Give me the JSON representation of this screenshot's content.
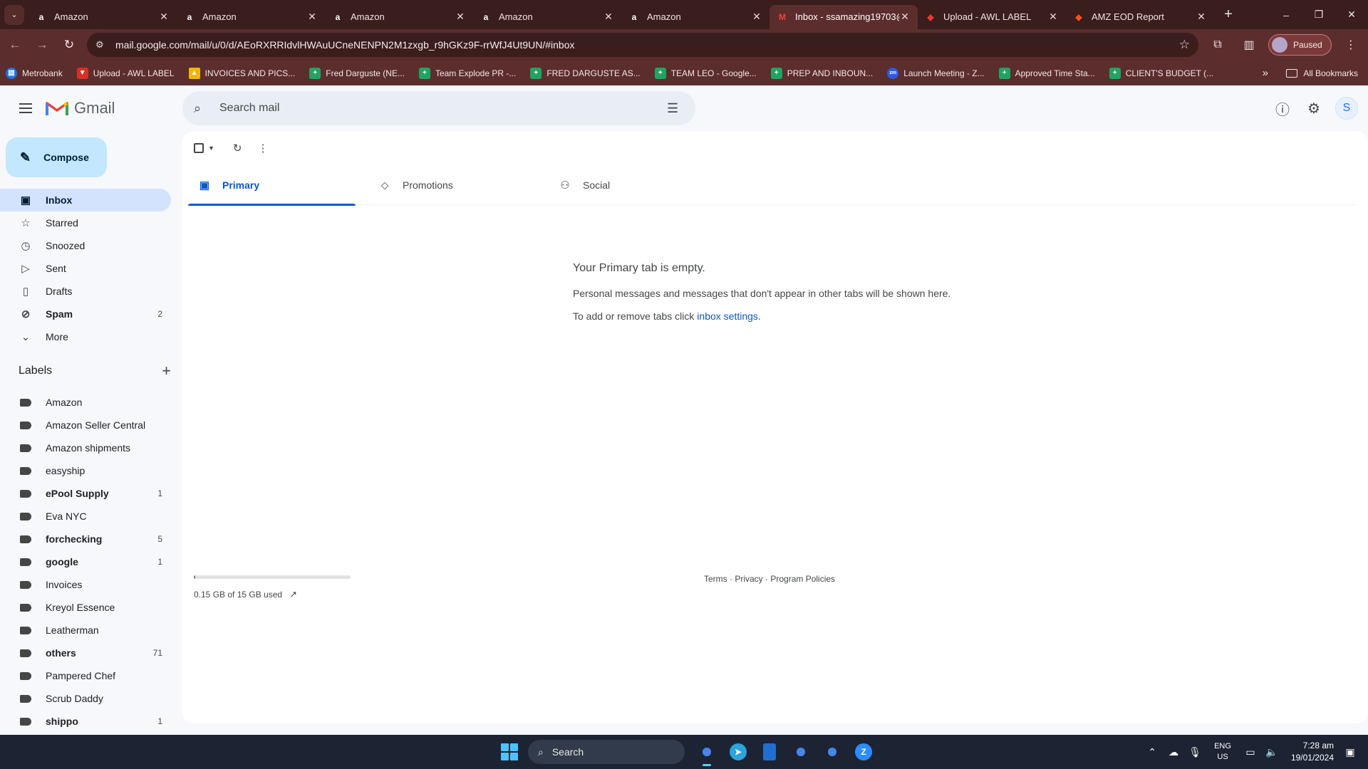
{
  "browser": {
    "tabs": [
      {
        "title": "Amazon",
        "favicon": "amazon-icon",
        "active": false
      },
      {
        "title": "Amazon",
        "favicon": "amazon-icon",
        "active": false
      },
      {
        "title": "Amazon",
        "favicon": "amazon-icon",
        "active": false
      },
      {
        "title": "Amazon",
        "favicon": "amazon-icon",
        "active": false
      },
      {
        "title": "Amazon",
        "favicon": "amazon-icon",
        "active": false
      },
      {
        "title": "Inbox - ssamazing19703@",
        "favicon": "gmail-icon",
        "active": true
      },
      {
        "title": "Upload - AWL LABEL",
        "favicon": "awl-icon",
        "active": false
      },
      {
        "title": "AMZ EOD Report",
        "favicon": "report-icon",
        "active": false
      }
    ],
    "url": "mail.google.com/mail/u/0/d/AEoRXRRIdvlHWAuUCneNENPN2M1zxgb_r9hGKz9F-rrWfJ4Ut9UN/#inbox",
    "profile_status": "Paused",
    "bookmarks": [
      {
        "label": "Metrobank",
        "icon": "blue"
      },
      {
        "label": "Upload - AWL LABEL",
        "icon": "red"
      },
      {
        "label": "INVOICES AND PICS...",
        "icon": "drive"
      },
      {
        "label": "Fred Darguste (NE...",
        "icon": "sheet"
      },
      {
        "label": "Team Explode PR -...",
        "icon": "sheet"
      },
      {
        "label": "FRED DARGUSTE AS...",
        "icon": "sheet"
      },
      {
        "label": "TEAM LEO - Google...",
        "icon": "sheet"
      },
      {
        "label": "PREP AND INBOUN...",
        "icon": "sheet"
      },
      {
        "label": "Launch Meeting - Z...",
        "icon": "zoom"
      },
      {
        "label": "Approved Time Sta...",
        "icon": "sheet"
      },
      {
        "label": "CLIENT'S BUDGET (...",
        "icon": "sheet"
      }
    ],
    "all_bookmarks_label": "All Bookmarks",
    "more_bookmarks": "»"
  },
  "gmail": {
    "brand": "Gmail",
    "search_placeholder": "Search mail",
    "avatar_letter": "S",
    "compose_label": "Compose",
    "nav": [
      {
        "label": "Inbox",
        "icon": "inbox-icon",
        "glyph": "▣",
        "count": "",
        "active": true,
        "bold": true
      },
      {
        "label": "Starred",
        "icon": "star-icon",
        "glyph": "☆",
        "count": "",
        "active": false,
        "bold": false
      },
      {
        "label": "Snoozed",
        "icon": "clock-icon",
        "glyph": "◷",
        "count": "",
        "active": false,
        "bold": false
      },
      {
        "label": "Sent",
        "icon": "send-icon",
        "glyph": "▷",
        "count": "",
        "active": false,
        "bold": false
      },
      {
        "label": "Drafts",
        "icon": "draft-icon",
        "glyph": "▯",
        "count": "",
        "active": false,
        "bold": false
      },
      {
        "label": "Spam",
        "icon": "spam-icon",
        "glyph": "⊘",
        "count": "2",
        "active": false,
        "bold": true
      },
      {
        "label": "More",
        "icon": "chevron-down-icon",
        "glyph": "⌄",
        "count": "",
        "active": false,
        "bold": false
      }
    ],
    "labels_heading": "Labels",
    "labels": [
      {
        "label": "Amazon",
        "count": "",
        "bold": false
      },
      {
        "label": "Amazon Seller Central",
        "count": "",
        "bold": false
      },
      {
        "label": "Amazon shipments",
        "count": "",
        "bold": false
      },
      {
        "label": "easyship",
        "count": "",
        "bold": false
      },
      {
        "label": "ePool Supply",
        "count": "1",
        "bold": true
      },
      {
        "label": "Eva NYC",
        "count": "",
        "bold": false
      },
      {
        "label": "forchecking",
        "count": "5",
        "bold": true
      },
      {
        "label": "google",
        "count": "1",
        "bold": true
      },
      {
        "label": "Invoices",
        "count": "",
        "bold": false
      },
      {
        "label": "Kreyol Essence",
        "count": "",
        "bold": false
      },
      {
        "label": "Leatherman",
        "count": "",
        "bold": false
      },
      {
        "label": "others",
        "count": "71",
        "bold": true
      },
      {
        "label": "Pampered Chef",
        "count": "",
        "bold": false
      },
      {
        "label": "Scrub Daddy",
        "count": "",
        "bold": false
      },
      {
        "label": "shippo",
        "count": "1",
        "bold": true
      }
    ],
    "category_tabs": [
      {
        "label": "Primary",
        "icon": "inbox-tab-icon",
        "active": true
      },
      {
        "label": "Promotions",
        "icon": "tag-icon",
        "active": false
      },
      {
        "label": "Social",
        "icon": "people-icon",
        "active": false
      }
    ],
    "empty_state": {
      "title": "Your Primary tab is empty.",
      "line1": "Personal messages and messages that don't appear in other tabs will be shown here.",
      "line2_prefix": "To add or remove tabs click ",
      "line2_link": "inbox settings",
      "line2_suffix": "."
    },
    "storage": {
      "text": "0.15 GB of 15 GB used",
      "fraction": 0.01
    },
    "footer": {
      "terms": "Terms",
      "privacy": "Privacy",
      "policies": "Program Policies",
      "sep": " · "
    }
  },
  "taskbar": {
    "search_label": "Search",
    "lang_line1": "ENG",
    "lang_line2": "US",
    "time": "7:28 am",
    "date": "19/01/2024"
  }
}
